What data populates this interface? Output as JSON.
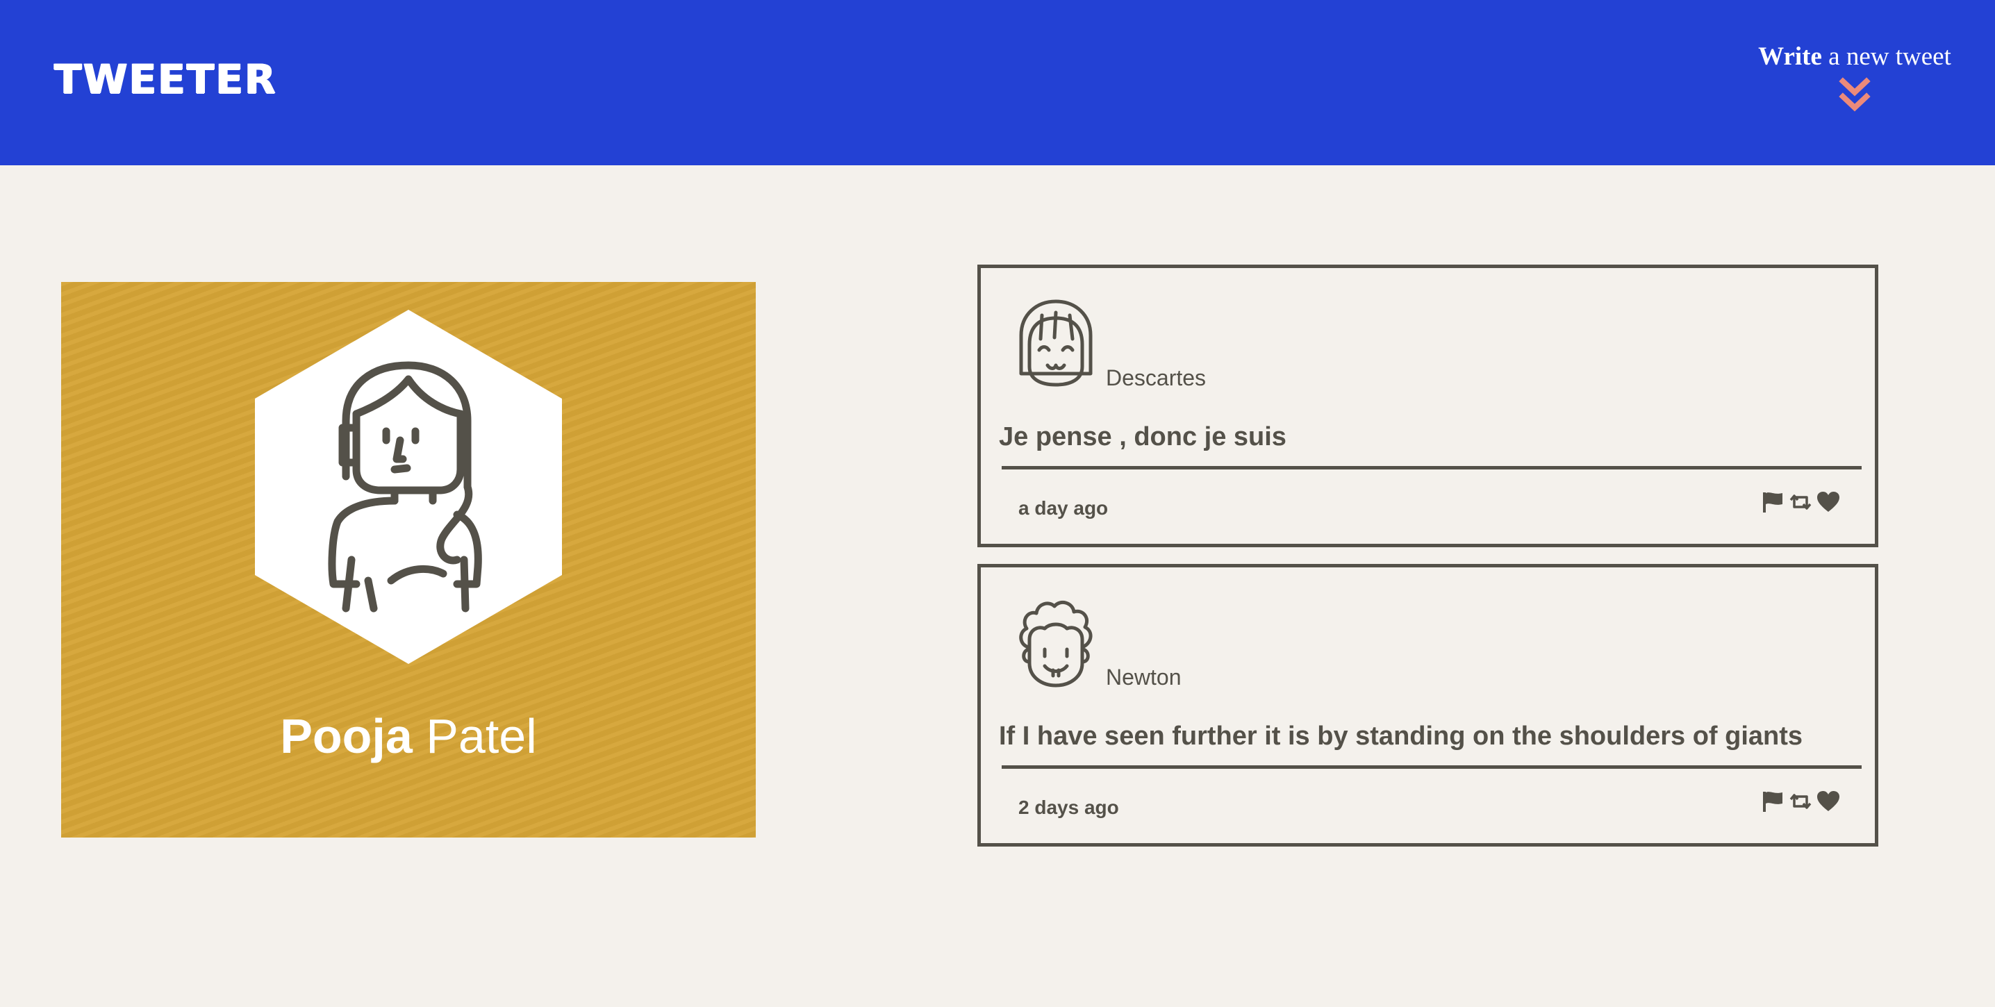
{
  "nav": {
    "logo": "TWEETER",
    "compose_bold": "Write",
    "compose_rest": " a new tweet",
    "compose_icon": "double-chevron-down-icon"
  },
  "profile": {
    "first_name": "Pooja",
    "last_name": "Patel",
    "avatar": "girl-avatar-icon"
  },
  "tweets": [
    {
      "author": "Descartes",
      "avatar": "bob-haircut-avatar-icon",
      "text": "Je pense , donc je suis",
      "time": "a day ago",
      "actions": [
        "flag-icon",
        "retweet-icon",
        "heart-icon"
      ]
    },
    {
      "author": "Newton",
      "avatar": "curly-hair-avatar-icon",
      "text": "If I have seen further it is by standing on the shoulders of giants",
      "time": "2 days ago",
      "actions": [
        "flag-icon",
        "retweet-icon",
        "heart-icon"
      ]
    }
  ],
  "colors": {
    "nav_bg": "#2341d4",
    "accent_chevron": "#ec8a7a",
    "profile_bg": "#d6a537",
    "page_bg": "#f4f1ec",
    "ink": "#545149"
  }
}
